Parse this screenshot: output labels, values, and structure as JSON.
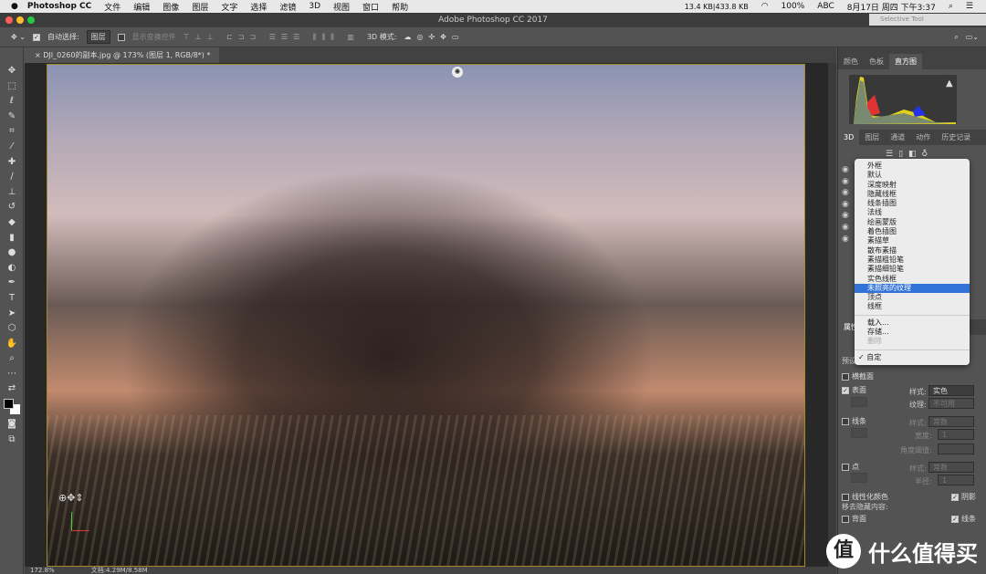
{
  "menubar": {
    "app": "Photoshop CC",
    "items": [
      "文件",
      "编辑",
      "图像",
      "图层",
      "文字",
      "选择",
      "滤镜",
      "3D",
      "视图",
      "窗口",
      "帮助"
    ],
    "net": "13.4 KB|433.8 KB",
    "battery": "100%",
    "input": "ABC",
    "clock": "8月17日 周四 下午3:37"
  },
  "window": {
    "title": "Adobe Photoshop CC 2017",
    "floating": "Selective Tool"
  },
  "options": {
    "auto_select_label": "自动选择:",
    "auto_select_value": "图层",
    "show_transform": "显示变换控件",
    "mode_3d": "3D 模式:"
  },
  "document": {
    "tab": "DJI_0260的副本.jpg @ 173% (图层 1, RGB/8*) *"
  },
  "status": {
    "zoom": "172.8%",
    "doc": "文档:4.29M/8.58M"
  },
  "tools": [
    "move",
    "marquee",
    "lasso",
    "quick-select",
    "crop",
    "eyedropper",
    "healing",
    "brush",
    "stamp",
    "history-brush",
    "eraser",
    "gradient",
    "blur",
    "dodge",
    "pen",
    "type",
    "path-select",
    "shape",
    "hand",
    "zoom",
    "more",
    "swap",
    "colors",
    "quickmask",
    "screen-mode"
  ],
  "panels": {
    "top_tabs": [
      "颜色",
      "色板",
      "直方图"
    ],
    "mid_tabs": [
      "3D",
      "图层",
      "通道",
      "动作",
      "历史记录"
    ],
    "props_title": "属性",
    "preset_label": "预设:"
  },
  "render_menu": {
    "items": [
      "外框",
      "默认",
      "深度映射",
      "隐藏线框",
      "线条插图",
      "法线",
      "绘画蒙版",
      "着色插图",
      "素描草",
      "散布素描",
      "素描粗铅笔",
      "素描细铅笔",
      "实色线框",
      "未照亮的纹理",
      "顶点",
      "线框"
    ],
    "highlighted": "未照亮的纹理",
    "actions": [
      "载入...",
      "存储...",
      "删除"
    ],
    "checked": "自定"
  },
  "props": {
    "cross_section": "横截面",
    "surface": "表面",
    "style_label": "样式:",
    "surface_style": "实色",
    "texture_label": "纹理:",
    "texture_value": "不可用",
    "lines": "线条",
    "lines_style": "常数",
    "width_label": "宽度:",
    "width_value": "1",
    "angle_label": "角度阈值:",
    "points": "点",
    "points_style": "常数",
    "radius_label": "半径:",
    "radius_value": "1",
    "linearize": "线性化颜色",
    "shadow": "阴影",
    "remove_hidden": "移去隐藏内容:",
    "back": "背面",
    "lines2": "线条"
  },
  "watermark": {
    "glyph": "值",
    "text": "什么值得买"
  },
  "colors": {
    "highlight": "#3173d6",
    "canvas_border": "#a68a2a"
  }
}
